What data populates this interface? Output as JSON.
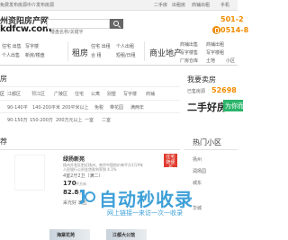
{
  "topbar": {
    "links": [
      "免费发布房源",
      "中介发布房源"
    ],
    "right_links": [
      "二手房",
      "出租房",
      "商铺出租",
      "手机"
    ]
  },
  "logo": {
    "line1": "州资阳房产网",
    "line2": "kdfcw.com"
  },
  "search": {
    "placeholder": "楼盘名称/关键字"
  },
  "phones": [
    "0514-8",
    "501-2"
  ],
  "nav": [
    {
      "label": "二手房",
      "sub": [
        "住宅 出售",
        "写字楼",
        "个人出售",
        "新房/楼盘"
      ]
    },
    {
      "label": "租房",
      "sub": [
        "住宅 出租",
        "个人出租",
        "合 租",
        "短租/日租"
      ]
    },
    {
      "label": "商业地产",
      "sub": [
        "商铺出售",
        "商铺出租",
        "写字楼售",
        "写字楼租"
      ]
    },
    {
      "label": "",
      "sub": [
        "厂房仓库",
        "土地",
        "小区"
      ]
    }
  ],
  "filters": {
    "title": "房",
    "rows": [
      {
        "label": "区",
        "options": [
          "江都区",
          "邗江区",
          "广陵区",
          "住宅",
          "公寓",
          "别墅",
          "写字楼",
          "商铺"
        ]
      },
      {
        "label": "",
        "options": [
          "90-140平",
          "140-200平米",
          "200平米以上",
          "免税",
          "带花园",
          "满两年"
        ]
      },
      {
        "label": "",
        "options": [
          "90-150万",
          "150-200万",
          "200万元以上",
          "一室",
          "二室"
        ]
      }
    ]
  },
  "sell_panel": {
    "title": "我要卖房",
    "label": "已售房源",
    "count": "52698",
    "headline": "二手好房",
    "tag": "为你而选"
  },
  "listing": {
    "title": "荐",
    "items": [
      {
        "name": "绿扬新苑",
        "desc1": "扬州开发区附近扬州，南京中国房价每平方1万9年",
        "desc2": "人民银行公积金贷款利率到 4.1%",
        "text1": "4室2厅2卫（满二）",
        "price": "170",
        "unit": "平方米",
        "price2": "82.8",
        "unit2": "万元",
        "text2": "采光好 满五",
        "badge": "住宅 随便看"
      }
    ],
    "bottom_items": [
      "海棠花苑",
      "江都大公馆"
    ]
  },
  "hot": {
    "title": "热门小区",
    "items": [
      "扬州",
      "润扬园",
      "城东",
      "华城"
    ]
  },
  "watermark": {
    "text": "自动秒收录",
    "sub": "网上链接一来访一次一收录"
  },
  "colors": {
    "accent_orange": "#f08c00",
    "green": "#2bb56b",
    "red": "#e03b2e",
    "watermark_blue": "#3fa0d8"
  }
}
